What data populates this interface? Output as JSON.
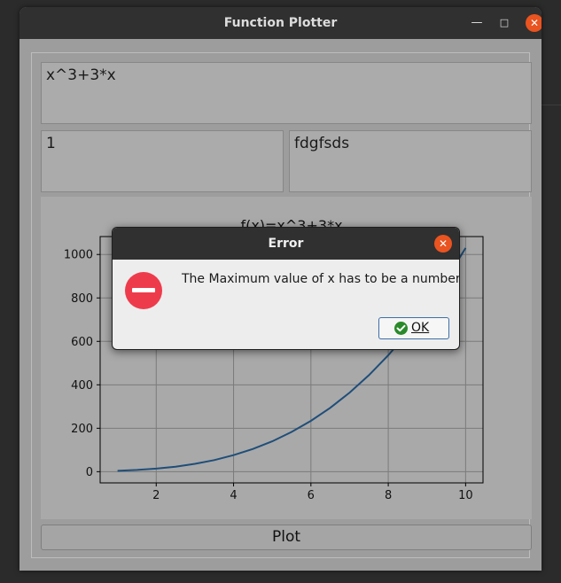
{
  "window": {
    "title": "Function Plotter"
  },
  "inputs": {
    "function_value": "x^3+3*x",
    "min_value": "1",
    "max_value": "fdgfsds"
  },
  "plot_button": {
    "label": "Plot"
  },
  "chart_data": {
    "type": "line",
    "title": "f(x)=x^3+3*x",
    "xlabel": "",
    "ylabel": "",
    "xlim": [
      0.55,
      10.45
    ],
    "ylim": [
      -51.5,
      1082.5
    ],
    "xticks": [
      2,
      4,
      6,
      8,
      10
    ],
    "yticks": [
      0,
      200,
      400,
      600,
      800,
      1000
    ],
    "grid": true,
    "series": [
      {
        "x": [
          1,
          1.5,
          2,
          2.5,
          3,
          3.5,
          4,
          4.5,
          5,
          5.5,
          6,
          6.5,
          7,
          7.5,
          8,
          8.5,
          9,
          9.5,
          10
        ],
        "y": [
          4,
          7.88,
          14,
          23.13,
          36,
          53.38,
          76,
          104.63,
          140,
          182.88,
          234,
          294.13,
          364,
          444.38,
          536,
          639.63,
          756,
          885.88,
          1030
        ],
        "color": "#1f4e79"
      }
    ]
  },
  "dialog": {
    "title": "Error",
    "message": "The Maximum value of x has to be a number!",
    "ok_label": "OK"
  }
}
